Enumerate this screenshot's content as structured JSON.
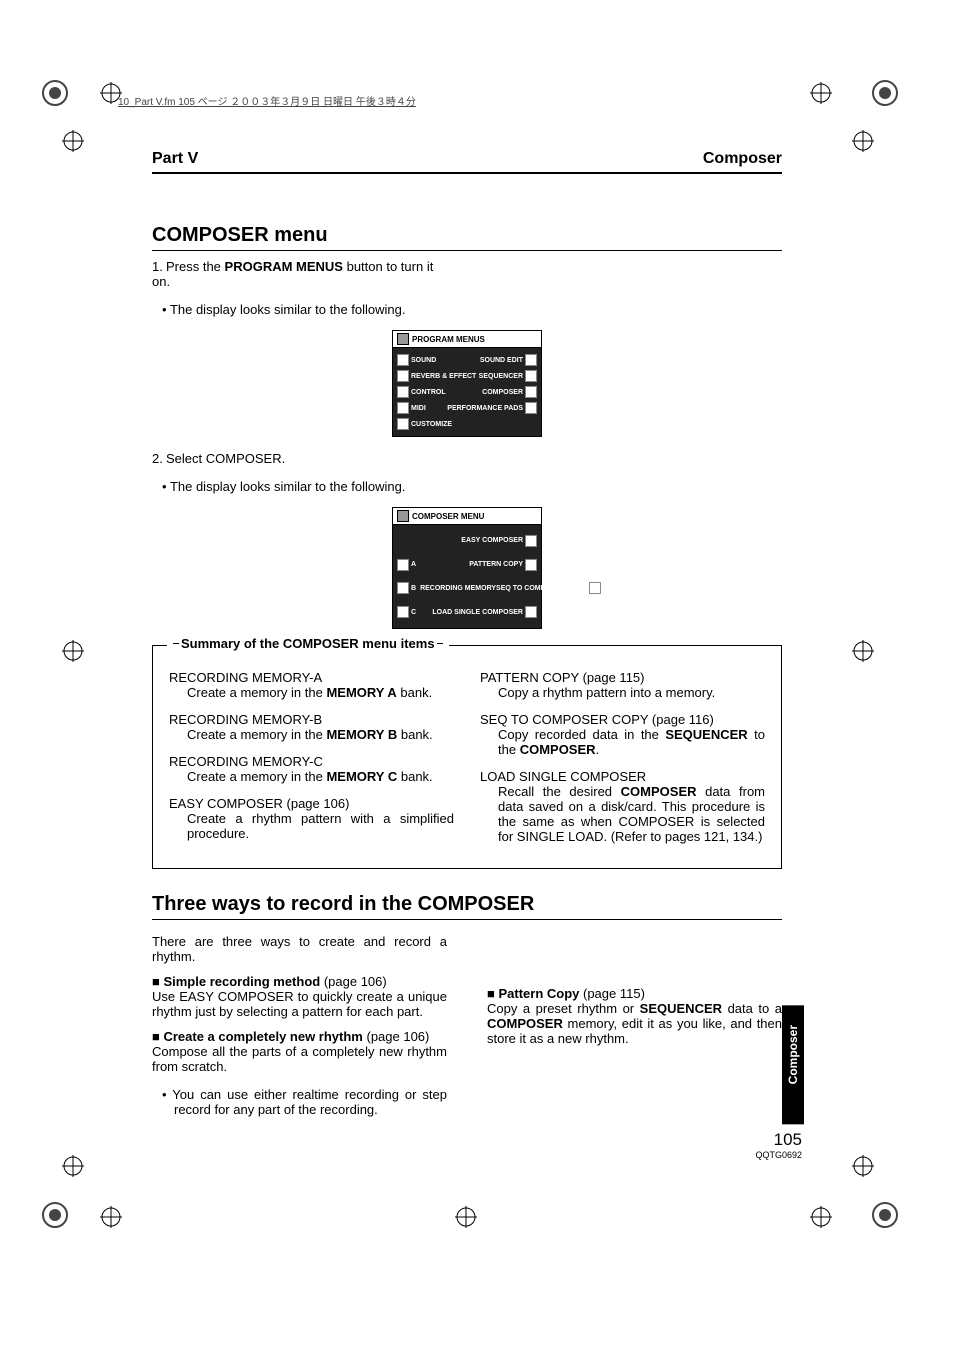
{
  "print_meta": "10_Part V.fm 105 ページ ２００３年３月９日 日曜日 午後３時４分",
  "header": {
    "left": "Part V",
    "right": "Composer"
  },
  "section1": {
    "title": "COMPOSER menu",
    "step1_num": "1.",
    "step1_text_before": "Press the ",
    "step1_bold": "PROGRAM MENUS",
    "step1_text_after": " button to turn it on.",
    "bullet1": "The display looks similar to the following.",
    "lcd1": {
      "title": "PROGRAM MENUS",
      "left": [
        "SOUND",
        "REVERB & EFFECT",
        "CONTROL",
        "MIDI",
        "CUSTOMIZE"
      ],
      "right": [
        "SOUND EDIT",
        "SEQUENCER",
        "COMPOSER",
        "PERFORMANCE PADS",
        ""
      ]
    },
    "step2_num": "2.",
    "step2_text": "Select COMPOSER.",
    "bullet2": "The display looks similar to the following.",
    "lcd2": {
      "title": "COMPOSER MENU",
      "left_group_label": "RECORDING MEMORY",
      "left_letters": [
        "A",
        "B",
        "C"
      ],
      "right": [
        "EASY COMPOSER",
        "PATTERN COPY",
        "SEQ TO COMPOSER COPY",
        "LOAD SINGLE COMPOSER"
      ]
    }
  },
  "summary": {
    "title": "Summary of the COMPOSER menu items",
    "left": [
      {
        "title": "RECORDING MEMORY-A",
        "desc_pre": "Create a memory in the ",
        "desc_bold": "MEMORY A",
        "desc_post": " bank."
      },
      {
        "title": "RECORDING MEMORY-B",
        "desc_pre": "Create a memory in the ",
        "desc_bold": "MEMORY B",
        "desc_post": " bank."
      },
      {
        "title": "RECORDING MEMORY-C",
        "desc_pre": "Create a memory in the ",
        "desc_bold": "MEMORY C",
        "desc_post": " bank."
      },
      {
        "title": "EASY COMPOSER (page 106)",
        "desc_pre": "Create a rhythm pattern with a simplified procedure.",
        "desc_bold": "",
        "desc_post": ""
      }
    ],
    "right": [
      {
        "title": "PATTERN COPY (page 115)",
        "desc_pre": "Copy a rhythm pattern into a memory.",
        "desc_bold": "",
        "desc_post": ""
      },
      {
        "title": "SEQ TO COMPOSER COPY (page 116)",
        "desc_pre": "Copy recorded data in the ",
        "desc_bold": "SEQUENCER",
        "desc_post": " to the ",
        "desc_bold2": "COMPOSER",
        "desc_post2": "."
      },
      {
        "title": "LOAD SINGLE COMPOSER",
        "desc_pre": "Recall the desired ",
        "desc_bold": "COMPOSER",
        "desc_post": " data from data saved on a disk/card. This procedure is the same as when COMPOSER is selected for SINGLE LOAD. (Refer to pages 121, 134.)"
      }
    ]
  },
  "section2": {
    "title": "Three ways to record in the COMPOSER",
    "intro": "There are three ways to create and record a rhythm.",
    "left": {
      "m1_title": "Simple recording method",
      "m1_page": " (page 106)",
      "m1_body": "Use EASY COMPOSER to quickly create a unique rhythm just by selecting a pattern for each part.",
      "m2_title": "Create a completely new rhythm",
      "m2_page": " (page 106)",
      "m2_body": "Compose all the parts of a completely new rhythm from scratch.",
      "m2_bullet": "You can use either realtime recording or step record for any part of the recording."
    },
    "right": {
      "m3_title": "Pattern Copy",
      "m3_page": " (page 115)",
      "m3_body_pre": "Copy a preset rhythm or ",
      "m3_bold1": "SEQUENCER",
      "m3_mid": " data to a ",
      "m3_bold2": "COMPOSER",
      "m3_body_post": " memory, edit it as you like, and then store it as a new rhythm."
    }
  },
  "side_tab": "Composer",
  "footer": {
    "page": "105",
    "code": "QQTG0692"
  }
}
